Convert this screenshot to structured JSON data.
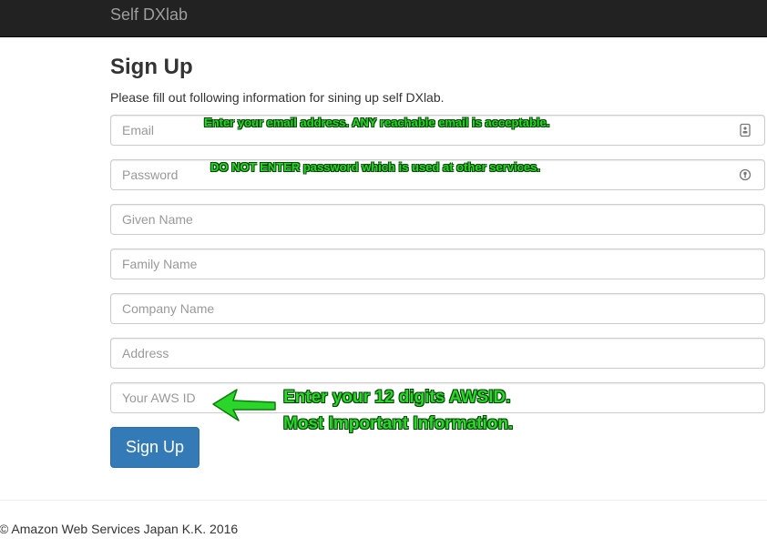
{
  "navbar": {
    "brand": "Self DXlab"
  },
  "form": {
    "title": "Sign Up",
    "intro": "Please fill out following information for sining up self DXlab.",
    "fields": [
      {
        "placeholder": "Email",
        "icon": "contact-card-icon"
      },
      {
        "placeholder": "Password",
        "icon": "password-key-icon"
      },
      {
        "placeholder": "Given Name"
      },
      {
        "placeholder": "Family Name"
      },
      {
        "placeholder": "Company Name"
      },
      {
        "placeholder": "Address"
      },
      {
        "placeholder": "Your AWS ID"
      }
    ],
    "submit_label": "Sign Up"
  },
  "annotations": {
    "email_note": "Enter your email address. ANY reachable email is acceptable.",
    "password_note": "DO NOT ENTER password which is used at other services.",
    "awsid_line1": "Enter your 12 digits AWSID.",
    "awsid_line2": "Most Important Information.",
    "color": "#2bd62b",
    "arrow_icon": "left-arrow-icon"
  },
  "footer": {
    "copyright": "© Amazon Web Services Japan K.K. 2016"
  },
  "colors": {
    "navbar_bg": "#222222",
    "brand_text": "#9d9d9d",
    "primary_button": "#337ab7",
    "annotation_green": "#2bd62b"
  }
}
